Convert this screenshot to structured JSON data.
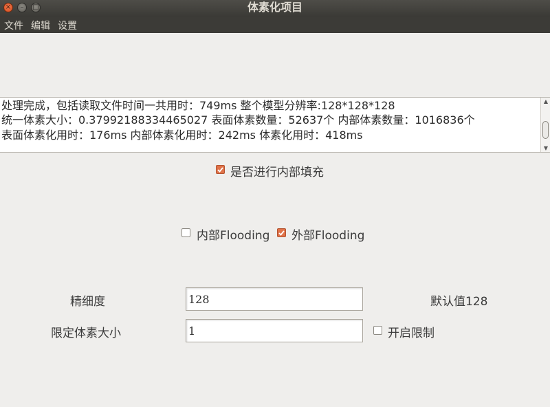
{
  "window": {
    "title": "体素化项目",
    "close_glyph": "×",
    "min_glyph": "–",
    "max_glyph": "□"
  },
  "menu": {
    "items": [
      "文件",
      "编辑",
      "设置"
    ]
  },
  "log": {
    "lines": [
      "处理完成，包括读取文件时间一共用时：749ms 整个模型分辨率:128*128*128",
      " 统一体素大小：0.37992188334465027 表面体素数量：52637个 内部体素数量：1016836个",
      "表面体素化用时：176ms 内部体素化用时：242ms 体素化用时：418ms"
    ],
    "scroll_up": "▲",
    "scroll_down": "▼"
  },
  "fill_option": {
    "label": "是否进行内部填充",
    "checked": true
  },
  "flooding": {
    "internal_label": "内部Flooding",
    "internal_checked": false,
    "external_label": "外部Flooding",
    "external_checked": true
  },
  "precision": {
    "label": "精细度",
    "value": "128",
    "default_note": "默认值128"
  },
  "voxel_limit": {
    "label": "限定体素大小",
    "value": "1",
    "enable_label": "开启限制",
    "enable_checked": false
  },
  "colors": {
    "accent": "#e0734a",
    "titlebar": "#3c3b37",
    "background": "#efeeec"
  }
}
